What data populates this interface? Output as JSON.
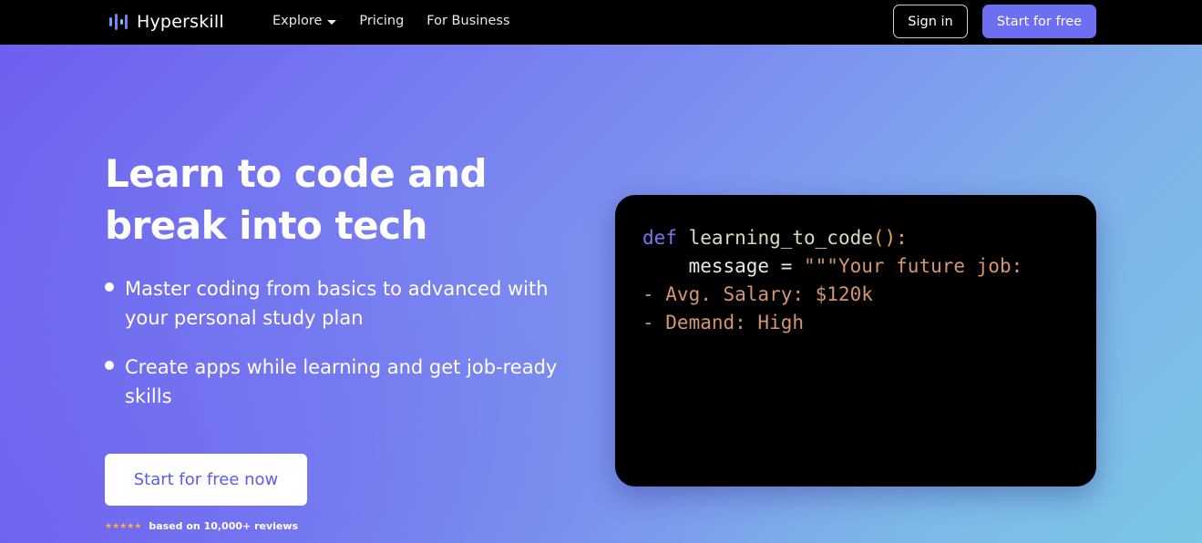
{
  "nav": {
    "brand": "Hyperskill",
    "links": [
      {
        "label": "Explore",
        "has_dropdown": true
      },
      {
        "label": "Pricing"
      },
      {
        "label": "For Business"
      }
    ],
    "sign_in": "Sign in",
    "start_free": "Start for free"
  },
  "hero": {
    "title": "Learn to code and break into tech",
    "bullets": [
      "Master coding from basics to advanced with your personal study plan",
      "Create apps while learning and get job-ready skills"
    ],
    "cta": "Start for free now",
    "rating_text": "based on 10,000+ reviews",
    "stars": "★★★★★"
  },
  "code": {
    "line1_kw": "def",
    "line1_fn": "learning_to_code",
    "line1_punct": "():",
    "line2_indent": "    message = ",
    "line2_str": "\"\"\"Your future job:",
    "line3": "- Avg. Salary: $120k",
    "line4": "- Demand: High"
  },
  "colors": {
    "accent": "#6e6ef2",
    "code_keyword": "#7b74f0",
    "code_string": "#d49570",
    "star": "#f5b43c"
  },
  "icons": {
    "logo": "hyperskill-logo-icon",
    "dropdown": "caret-down-icon"
  }
}
